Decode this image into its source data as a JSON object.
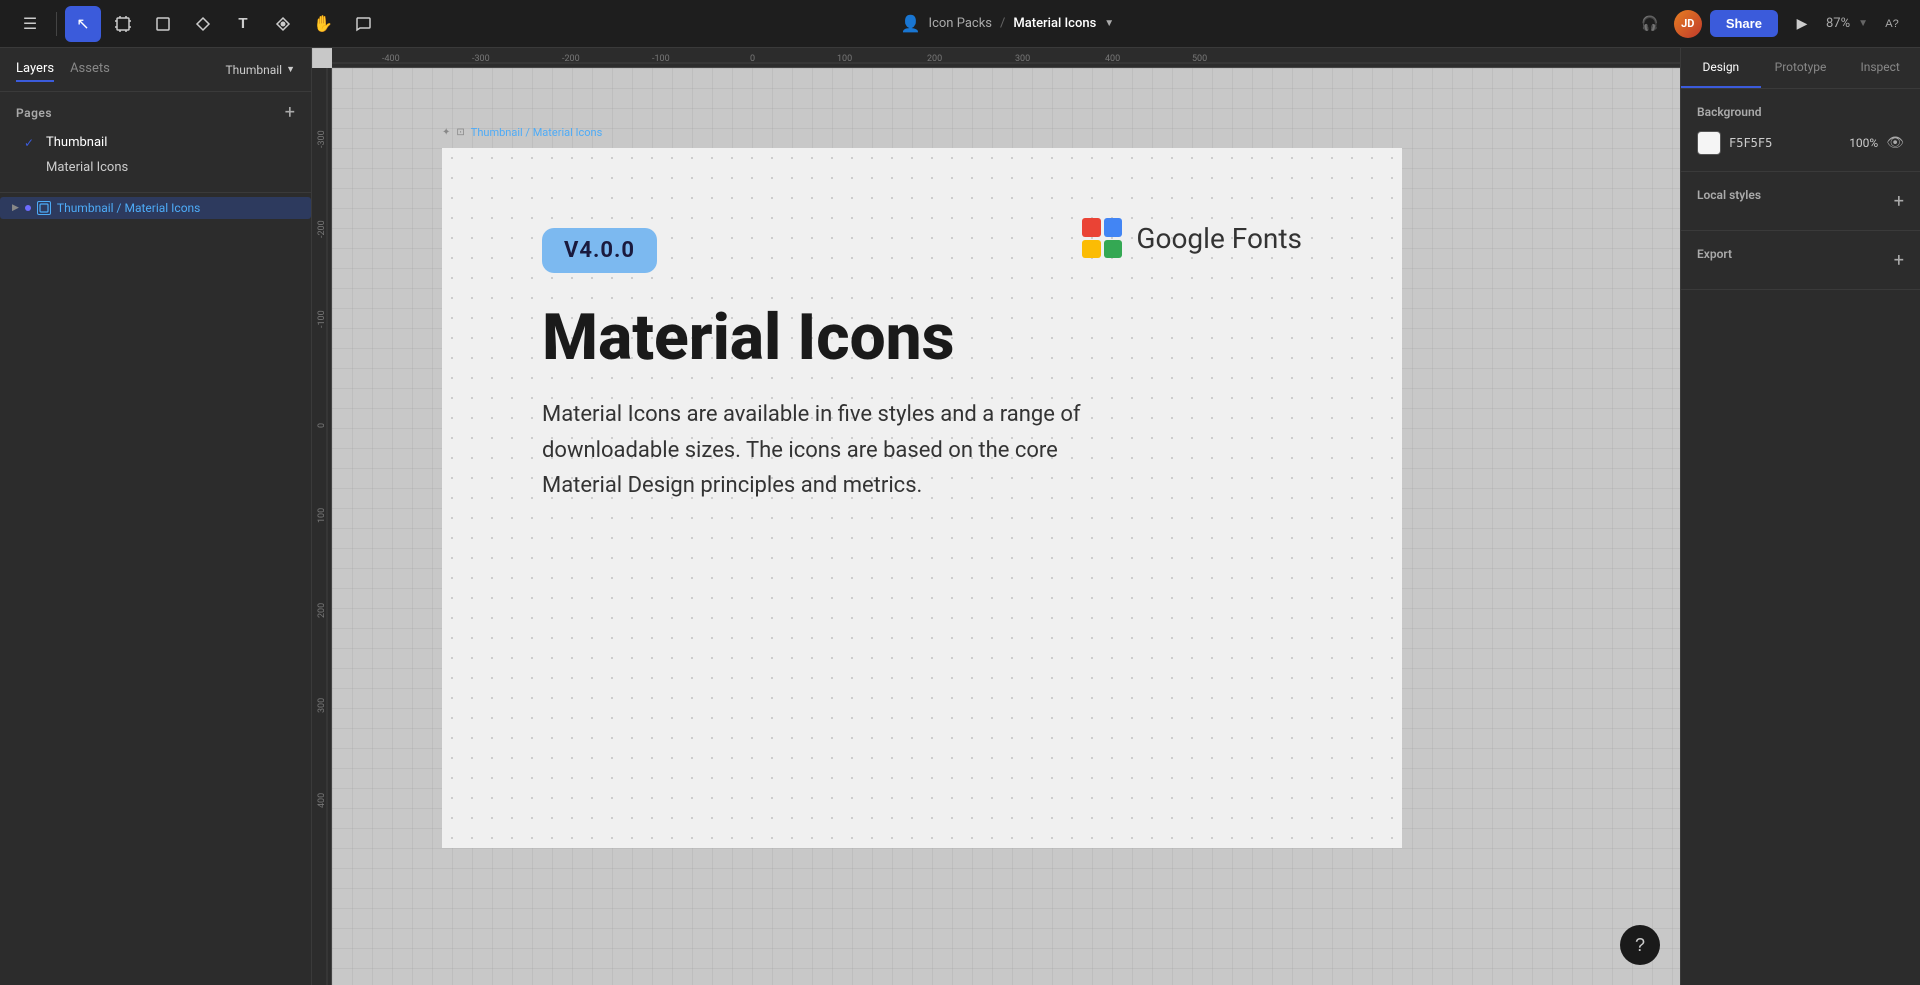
{
  "toolbar": {
    "title": "Material Icons",
    "breadcrumb": {
      "parent": "Icon Packs",
      "separator": "/",
      "current": "Material Icons"
    },
    "share_label": "Share",
    "zoom_level": "87%",
    "tools": [
      {
        "id": "menu",
        "icon": "☰",
        "name": "menu-tool"
      },
      {
        "id": "move",
        "icon": "↖",
        "name": "move-tool",
        "active": true
      },
      {
        "id": "frame",
        "icon": "⬚",
        "name": "frame-tool"
      },
      {
        "id": "shape",
        "icon": "□",
        "name": "shape-tool"
      },
      {
        "id": "pen",
        "icon": "✒",
        "name": "pen-tool"
      },
      {
        "id": "text",
        "icon": "T",
        "name": "text-tool"
      },
      {
        "id": "component",
        "icon": "❖",
        "name": "component-tool"
      },
      {
        "id": "hand",
        "icon": "✋",
        "name": "hand-tool"
      },
      {
        "id": "comment",
        "icon": "💬",
        "name": "comment-tool"
      }
    ]
  },
  "left_panel": {
    "tabs": [
      {
        "id": "layers",
        "label": "Layers",
        "active": true
      },
      {
        "id": "assets",
        "label": "Assets"
      }
    ],
    "thumbnail_selector": "Thumbnail",
    "pages": {
      "title": "Pages",
      "items": [
        {
          "id": "thumbnail",
          "label": "Thumbnail",
          "active": true
        },
        {
          "id": "material-icons",
          "label": "Material Icons"
        }
      ]
    },
    "layers": [
      {
        "id": "thumbnail-material-icons",
        "label": "Thumbnail / Material Icons",
        "type": "frame",
        "selected": true,
        "expanded": false
      }
    ]
  },
  "canvas": {
    "frame_label": "Thumbnail / Material Icons",
    "version_badge": "V4.0.0",
    "google_fonts_text": "Google Fonts",
    "main_title": "Material Icons",
    "description": "Material Icons are available in five styles and a range of downloadable sizes. The icons are based on the core Material Design principles and metrics.",
    "ruler_labels_h": [
      "-400",
      "-300",
      "-200",
      "-100",
      "0",
      "100",
      "200",
      "300",
      "400",
      "500"
    ],
    "ruler_labels_v": [
      "-300",
      "-200",
      "-100",
      "0",
      "100",
      "200",
      "300",
      "400"
    ]
  },
  "right_panel": {
    "tabs": [
      {
        "id": "design",
        "label": "Design",
        "active": true
      },
      {
        "id": "prototype",
        "label": "Prototype"
      },
      {
        "id": "inspect",
        "label": "Inspect"
      }
    ],
    "background": {
      "title": "Background",
      "color_hex": "F5F5F5",
      "opacity": "100%"
    },
    "local_styles": {
      "title": "Local styles"
    },
    "export": {
      "title": "Export"
    }
  },
  "help_button": "?"
}
